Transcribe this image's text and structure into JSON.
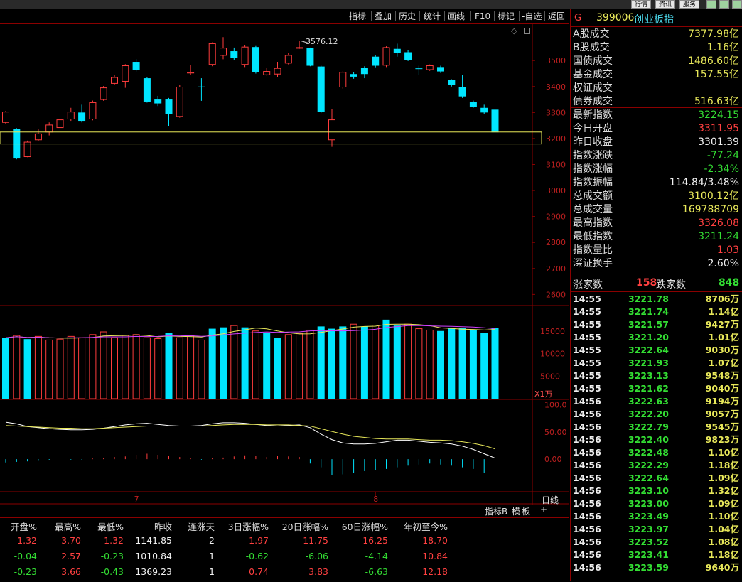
{
  "top_tabs": [
    "行情",
    "资讯",
    "服务"
  ],
  "toolbar": [
    "指标",
    "叠加",
    "历史",
    "统计",
    "画线",
    "F10",
    "标记",
    "-自选",
    "返回"
  ],
  "chart": {
    "peak_label": "3576.12",
    "price_axis": [
      "3500",
      "3400",
      "3300",
      "3200",
      "3100",
      "3000",
      "2900",
      "2800",
      "2700",
      "2600"
    ],
    "volume_axis": [
      "15000",
      "10000",
      "5000"
    ],
    "volume_unit": "X1万",
    "macd_axis": [
      "100.0",
      "50.00",
      "0.00"
    ],
    "month_labels": [
      "7",
      "8"
    ],
    "period": "日线",
    "bottom_buttons": [
      "指标B",
      "模",
      "板",
      "+",
      "-"
    ]
  },
  "chart_data": {
    "type": "candlestick",
    "ylim": [
      2560,
      3640
    ],
    "candles": [
      {
        "o": 3262,
        "c": 3302,
        "h": 3306,
        "l": 3255
      },
      {
        "o": 3238,
        "c": 3123,
        "h": 3240,
        "l": 3120
      },
      {
        "o": 3130,
        "c": 3186,
        "h": 3192,
        "l": 3128
      },
      {
        "o": 3195,
        "c": 3218,
        "h": 3238,
        "l": 3190
      },
      {
        "o": 3225,
        "c": 3252,
        "h": 3262,
        "l": 3212
      },
      {
        "o": 3242,
        "c": 3272,
        "h": 3282,
        "l": 3235
      },
      {
        "o": 3275,
        "c": 3302,
        "h": 3318,
        "l": 3268
      },
      {
        "o": 3300,
        "c": 3268,
        "h": 3330,
        "l": 3262
      },
      {
        "o": 3275,
        "c": 3338,
        "h": 3346,
        "l": 3270
      },
      {
        "o": 3350,
        "c": 3395,
        "h": 3402,
        "l": 3345
      },
      {
        "o": 3412,
        "c": 3435,
        "h": 3445,
        "l": 3405
      },
      {
        "o": 3420,
        "c": 3480,
        "h": 3486,
        "l": 3395
      },
      {
        "o": 3495,
        "c": 3465,
        "h": 3506,
        "l": 3458
      },
      {
        "o": 3432,
        "c": 3342,
        "h": 3436,
        "l": 3338
      },
      {
        "o": 3350,
        "c": 3335,
        "h": 3364,
        "l": 3325
      },
      {
        "o": 3350,
        "c": 3295,
        "h": 3356,
        "l": 3248
      },
      {
        "o": 3285,
        "c": 3398,
        "h": 3405,
        "l": 3280
      },
      {
        "o": 3452,
        "c": 3455,
        "h": 3482,
        "l": 3445
      },
      {
        "o": 3400,
        "c": 3398,
        "h": 3432,
        "l": 3345
      },
      {
        "o": 3485,
        "c": 3565,
        "h": 3570,
        "l": 3478
      },
      {
        "o": 3520,
        "c": 3548,
        "h": 3590,
        "l": 3505
      },
      {
        "o": 3536,
        "c": 3510,
        "h": 3550,
        "l": 3502
      },
      {
        "o": 3485,
        "c": 3552,
        "h": 3558,
        "l": 3475
      },
      {
        "o": 3552,
        "c": 3455,
        "h": 3556,
        "l": 3450
      },
      {
        "o": 3445,
        "c": 3458,
        "h": 3472,
        "l": 3442
      },
      {
        "o": 3448,
        "c": 3470,
        "h": 3495,
        "l": 3435
      },
      {
        "o": 3490,
        "c": 3520,
        "h": 3530,
        "l": 3485
      },
      {
        "o": 3550,
        "c": 3550,
        "h": 3576,
        "l": 3545
      },
      {
        "o": 3548,
        "c": 3480,
        "h": 3550,
        "l": 3478
      },
      {
        "o": 3477,
        "c": 3302,
        "h": 3480,
        "l": 3298
      },
      {
        "o": 3195,
        "c": 3272,
        "h": 3312,
        "l": 3168
      },
      {
        "o": 3398,
        "c": 3455,
        "h": 3458,
        "l": 3392
      },
      {
        "o": 3448,
        "c": 3438,
        "h": 3455,
        "l": 3430
      },
      {
        "o": 3472,
        "c": 3448,
        "h": 3478,
        "l": 3432
      },
      {
        "o": 3515,
        "c": 3480,
        "h": 3522,
        "l": 3474
      },
      {
        "o": 3482,
        "c": 3550,
        "h": 3555,
        "l": 3475
      },
      {
        "o": 3545,
        "c": 3530,
        "h": 3565,
        "l": 3515
      },
      {
        "o": 3532,
        "c": 3502,
        "h": 3540,
        "l": 3498
      },
      {
        "o": 3470,
        "c": 3468,
        "h": 3480,
        "l": 3445
      },
      {
        "o": 3465,
        "c": 3480,
        "h": 3485,
        "l": 3460
      },
      {
        "o": 3475,
        "c": 3458,
        "h": 3480,
        "l": 3452
      },
      {
        "o": 3425,
        "c": 3405,
        "h": 3428,
        "l": 3400
      },
      {
        "o": 3398,
        "c": 3362,
        "h": 3445,
        "l": 3356
      },
      {
        "o": 3342,
        "c": 3322,
        "h": 3346,
        "l": 3318
      },
      {
        "o": 3318,
        "c": 3300,
        "h": 3330,
        "l": 3295
      },
      {
        "o": 3311,
        "c": 3224,
        "h": 3326,
        "l": 3211
      }
    ],
    "volume": {
      "ylim": [
        0,
        20000
      ],
      "values": [
        13500,
        14000,
        13200,
        13800,
        13000,
        13200,
        13800,
        13500,
        14200,
        14800,
        13500,
        14000,
        14200,
        13500,
        13300,
        14500,
        13500,
        14000,
        13000,
        15500,
        15800,
        16200,
        15800,
        15000,
        14500,
        13500,
        14200,
        14500,
        15200,
        16000,
        15500,
        16000,
        16500,
        16000,
        16300,
        17500,
        16200,
        16500,
        15500,
        15200,
        15000,
        15600,
        15700,
        15200,
        14600,
        15600
      ],
      "up": [
        false,
        true,
        false,
        true,
        true,
        true,
        true,
        true,
        true,
        true,
        true,
        true,
        true,
        true,
        true,
        false,
        true,
        true,
        true,
        false,
        false,
        true,
        false,
        true,
        false,
        false,
        true,
        true,
        true,
        false,
        false,
        false,
        true,
        false,
        true,
        false,
        false,
        true,
        true,
        true,
        false,
        false,
        false,
        false,
        false,
        false
      ]
    },
    "macd": {
      "ylim": [
        -60,
        110
      ],
      "bars": [
        -6,
        -5,
        -4,
        -3,
        -2,
        -2,
        -1,
        -1,
        1,
        2,
        4,
        5,
        8,
        10,
        8,
        6,
        4,
        2,
        -1,
        2,
        3,
        5,
        7,
        6,
        4,
        6,
        5,
        4,
        -8,
        -15,
        -30,
        -28,
        -25,
        -22,
        -20,
        -18,
        -15,
        -12,
        -10,
        -8,
        -10,
        -12,
        -15,
        -18,
        -25,
        -48
      ],
      "dif": [
        68,
        65,
        60,
        58,
        56,
        55,
        54,
        54,
        55,
        57,
        60,
        63,
        65,
        66,
        64,
        62,
        61,
        61,
        62,
        65,
        67,
        67,
        66,
        64,
        62,
        61,
        62,
        63,
        58,
        46,
        36,
        30,
        28,
        28,
        29,
        32,
        35,
        35,
        33,
        31,
        30,
        28,
        24,
        18,
        10,
        2
      ],
      "dea": [
        62,
        61,
        60,
        59,
        58,
        57,
        57,
        56,
        56,
        57,
        58,
        59,
        60,
        61,
        61,
        61,
        61,
        61,
        61,
        62,
        63,
        64,
        64,
        64,
        63,
        63,
        63,
        62,
        61,
        56,
        51,
        46,
        42,
        40,
        38,
        37,
        37,
        37,
        36,
        35,
        35,
        34,
        32,
        29,
        25,
        19
      ]
    }
  },
  "info": {
    "code_flag": "G",
    "code": "399006",
    "name": "创业板指",
    "rows": [
      {
        "label": "A股成交",
        "value": "7377.98亿",
        "color": "yellow"
      },
      {
        "label": "B股成交",
        "value": "1.16亿",
        "color": "yellow"
      },
      {
        "label": "国债成交",
        "value": "1486.60亿",
        "color": "yellow"
      },
      {
        "label": "基金成交",
        "value": "157.55亿",
        "color": "yellow"
      },
      {
        "label": "权证成交",
        "value": "",
        "color": "yellow"
      },
      {
        "label": "债券成交",
        "value": "516.63亿",
        "color": "yellow"
      },
      {
        "label": "最新指数",
        "value": "3224.15",
        "color": "green"
      },
      {
        "label": "今日开盘",
        "value": "3311.95",
        "color": "red"
      },
      {
        "label": "昨日收盘",
        "value": "3301.39",
        "color": "white"
      },
      {
        "label": "指数涨跌",
        "value": "-77.24",
        "color": "green"
      },
      {
        "label": "指数涨幅",
        "value": "-2.34%",
        "color": "green"
      },
      {
        "label": "指数振幅",
        "value": "114.84/3.48%",
        "color": "white"
      },
      {
        "label": "总成交额",
        "value": "3100.12亿",
        "color": "yellow"
      },
      {
        "label": "总成交量",
        "value": "169788709",
        "color": "yellow"
      },
      {
        "label": "最高指数",
        "value": "3326.08",
        "color": "red"
      },
      {
        "label": "最低指数",
        "value": "3211.24",
        "color": "green"
      },
      {
        "label": "指数量比",
        "value": "1.03",
        "color": "red"
      },
      {
        "label": "深证换手",
        "value": "2.60%",
        "color": "white"
      }
    ],
    "rise_label": "涨家数",
    "rise_count": "158",
    "fall_label": "跌家数",
    "fall_count": "848"
  },
  "ticks": [
    {
      "t": "14:55",
      "p": "3221.78",
      "v": "8706万"
    },
    {
      "t": "14:55",
      "p": "3221.74",
      "v": "1.14亿"
    },
    {
      "t": "14:55",
      "p": "3221.57",
      "v": "9427万"
    },
    {
      "t": "14:55",
      "p": "3221.20",
      "v": "1.01亿"
    },
    {
      "t": "14:55",
      "p": "3222.64",
      "v": "9030万"
    },
    {
      "t": "14:55",
      "p": "3221.93",
      "v": "1.07亿"
    },
    {
      "t": "14:55",
      "p": "3223.13",
      "v": "9548万"
    },
    {
      "t": "14:55",
      "p": "3221.62",
      "v": "9040万"
    },
    {
      "t": "14:56",
      "p": "3222.63",
      "v": "9194万"
    },
    {
      "t": "14:56",
      "p": "3222.20",
      "v": "9057万"
    },
    {
      "t": "14:56",
      "p": "3222.79",
      "v": "9545万"
    },
    {
      "t": "14:56",
      "p": "3222.40",
      "v": "9823万"
    },
    {
      "t": "14:56",
      "p": "3222.48",
      "v": "1.10亿"
    },
    {
      "t": "14:56",
      "p": "3222.29",
      "v": "1.18亿"
    },
    {
      "t": "14:56",
      "p": "3222.64",
      "v": "1.09亿"
    },
    {
      "t": "14:56",
      "p": "3223.10",
      "v": "1.32亿"
    },
    {
      "t": "14:56",
      "p": "3223.00",
      "v": "1.09亿"
    },
    {
      "t": "14:56",
      "p": "3223.49",
      "v": "1.10亿"
    },
    {
      "t": "14:56",
      "p": "3223.97",
      "v": "1.04亿"
    },
    {
      "t": "14:56",
      "p": "3223.52",
      "v": "1.08亿"
    },
    {
      "t": "14:56",
      "p": "3223.41",
      "v": "1.18亿"
    },
    {
      "t": "14:56",
      "p": "3223.59",
      "v": "9640万"
    }
  ],
  "table": {
    "headers": [
      "开盘%",
      "最高%",
      "最低%",
      "昨收",
      "连涨天",
      "3日涨幅%",
      "20日涨幅%",
      "60日涨幅%",
      "年初至今%"
    ],
    "rows": [
      [
        "1.32",
        "3.70",
        "1.32",
        "1141.85",
        "2",
        "1.97",
        "11.75",
        "16.25",
        "18.70"
      ],
      [
        "-0.04",
        "2.57",
        "-0.23",
        "1010.84",
        "1",
        "-0.62",
        "-6.06",
        "-4.14",
        "10.84"
      ],
      [
        "-0.23",
        "3.66",
        "-0.43",
        "1369.23",
        "1",
        "0.74",
        "3.83",
        "-6.63",
        "12.18"
      ]
    ]
  },
  "colors": {
    "up": "#ff3c3c",
    "down": "#00e5ff",
    "ma_white": "#ffffff",
    "ma_yellow": "#e8e85a",
    "ma_purple": "#d040ff",
    "highlight": "#e8e85a"
  }
}
